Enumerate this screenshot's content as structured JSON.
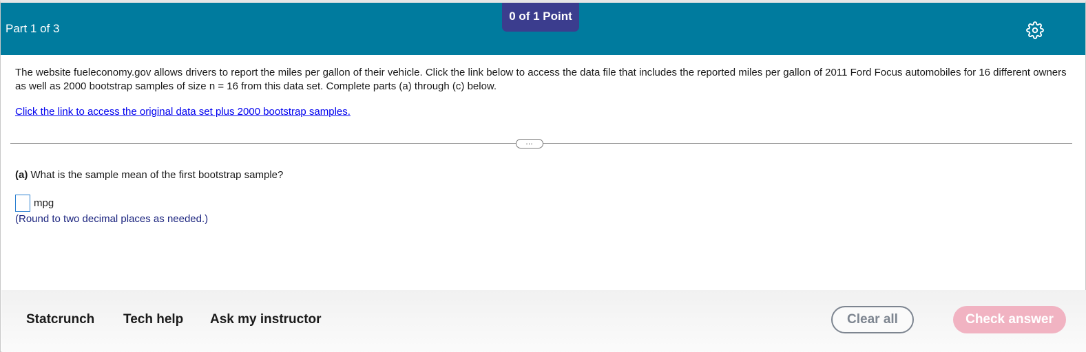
{
  "header": {
    "part_label": "Part 1 of 3",
    "points": "0 of 1 Point",
    "settings_icon": "gear-icon",
    "background_color": "#007b9e",
    "badge_color": "#3b3d8e"
  },
  "problem": {
    "text": "The website fueleconomy.gov allows drivers to report the miles per gallon of their vehicle.  Click the link below to access the data file that includes the reported miles per gallon of 2011 Ford Focus automobiles for 16 different owners as well as 2000 bootstrap samples of size n =  16 from this data set. Complete parts (a) through (c) below.",
    "link_text": "Click the link to access the original data set plus 2000 bootstrap samples."
  },
  "divider": {
    "expander_label": "…"
  },
  "question": {
    "part_label": "(a)",
    "text": " What is the sample mean of the first bootstrap sample?",
    "answer_value": "",
    "unit": "mpg",
    "hint": "(Round to two decimal places as needed.)"
  },
  "footer": {
    "links": [
      "Statcrunch",
      "Tech help",
      "Ask my instructor"
    ],
    "clear_label": "Clear all",
    "check_label": "Check answer",
    "check_color": "#f1b3c2"
  }
}
